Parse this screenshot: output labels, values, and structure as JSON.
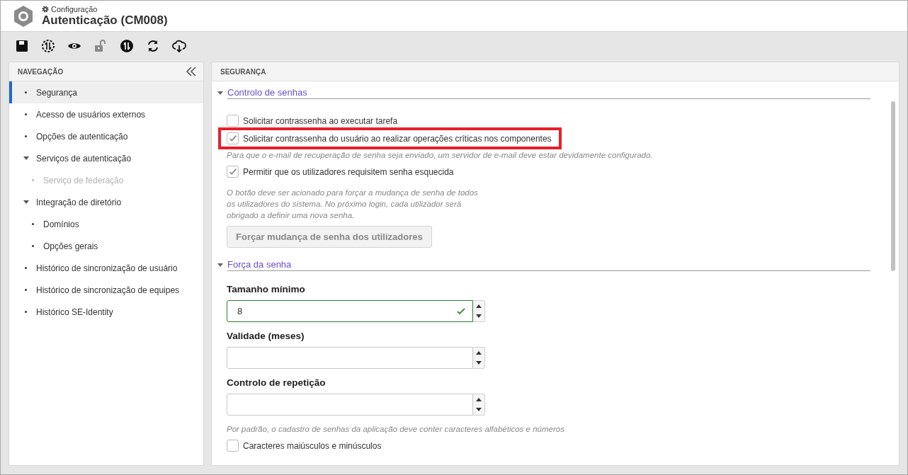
{
  "header": {
    "breadcrumb": "Configuração",
    "title": "Autenticação (CM008)"
  },
  "toolbar": [
    {
      "kind": "save",
      "disabled": false
    },
    {
      "kind": "dashed-sync",
      "disabled": false
    },
    {
      "kind": "eye",
      "disabled": false
    },
    {
      "kind": "unlock",
      "disabled": true
    },
    {
      "kind": "filled-sync",
      "disabled": false
    },
    {
      "kind": "refresh",
      "disabled": false
    },
    {
      "kind": "cloud-download",
      "disabled": false
    }
  ],
  "sidebar": {
    "title": "NAVEGAÇÃO",
    "items": [
      {
        "label": "Segurança",
        "selected": true,
        "disabled": false
      },
      {
        "label": "Acesso de usuários externos",
        "selected": false,
        "disabled": false
      },
      {
        "label": "Opções de autenticação",
        "selected": false,
        "disabled": false
      },
      {
        "label": "Serviços de autenticação",
        "selected": false,
        "disabled": false,
        "expanded": true,
        "children": [
          {
            "label": "Serviço de federação",
            "selected": false,
            "disabled": true
          }
        ]
      },
      {
        "label": "Integração de diretório",
        "selected": false,
        "disabled": false,
        "expanded": true,
        "children": [
          {
            "label": "Domínios",
            "selected": false,
            "disabled": false
          },
          {
            "label": "Opções gerais",
            "selected": false,
            "disabled": false
          }
        ]
      },
      {
        "label": "Histórico de sincronização de usuário",
        "selected": false,
        "disabled": false
      },
      {
        "label": "Histórico de sincronização de equipes",
        "selected": false,
        "disabled": false
      },
      {
        "label": "Histórico SE-Identity",
        "selected": false,
        "disabled": false
      }
    ]
  },
  "panel": {
    "title": "SEGURANÇA",
    "sections": [
      {
        "title": "Controlo de senhas",
        "expanded": true,
        "items": [
          {
            "kind": "checkbox",
            "label": "Solicitar contrassenha ao executar tarefa",
            "checked": false,
            "highlighted": false
          },
          {
            "kind": "checkbox",
            "label": "Solicitar contrassenha do usuário ao realizar operações críticas nos componentes",
            "checked": true,
            "highlighted": true
          },
          {
            "kind": "hint",
            "text": "Para que o e-mail de recuperação de senha seja enviado, um servidor de e-mail deve estar devidamente configurado."
          },
          {
            "kind": "checkbox",
            "label": "Permitir que os utilizadores requisitem senha esquecida",
            "checked": true,
            "highlighted": false
          },
          {
            "kind": "note",
            "text": "O botão deve ser acionado para forçar a mudança de senha de todos os utilizadores do sistema. No próximo login, cada utilizador será obrigado a definir uma nova senha."
          },
          {
            "kind": "button",
            "label": "Forçar mudança de senha dos utilizadores"
          }
        ]
      },
      {
        "title": "Força da senha",
        "expanded": true,
        "items": [
          {
            "kind": "number",
            "label": "Tamanho mínimo",
            "value": "8",
            "valid": true
          },
          {
            "kind": "number",
            "label": "Validade (meses)",
            "valid": false
          },
          {
            "kind": "number",
            "label": "Controlo de repetição",
            "valid": false
          },
          {
            "kind": "hint",
            "text": "Por padrão, o cadastro de senhas da aplicação deve conter caracteres alfabéticos e números"
          },
          {
            "kind": "checkbox",
            "label": "Caracteres maiúsculos e minúsculos",
            "checked": false,
            "highlighted": false
          }
        ]
      }
    ]
  }
}
